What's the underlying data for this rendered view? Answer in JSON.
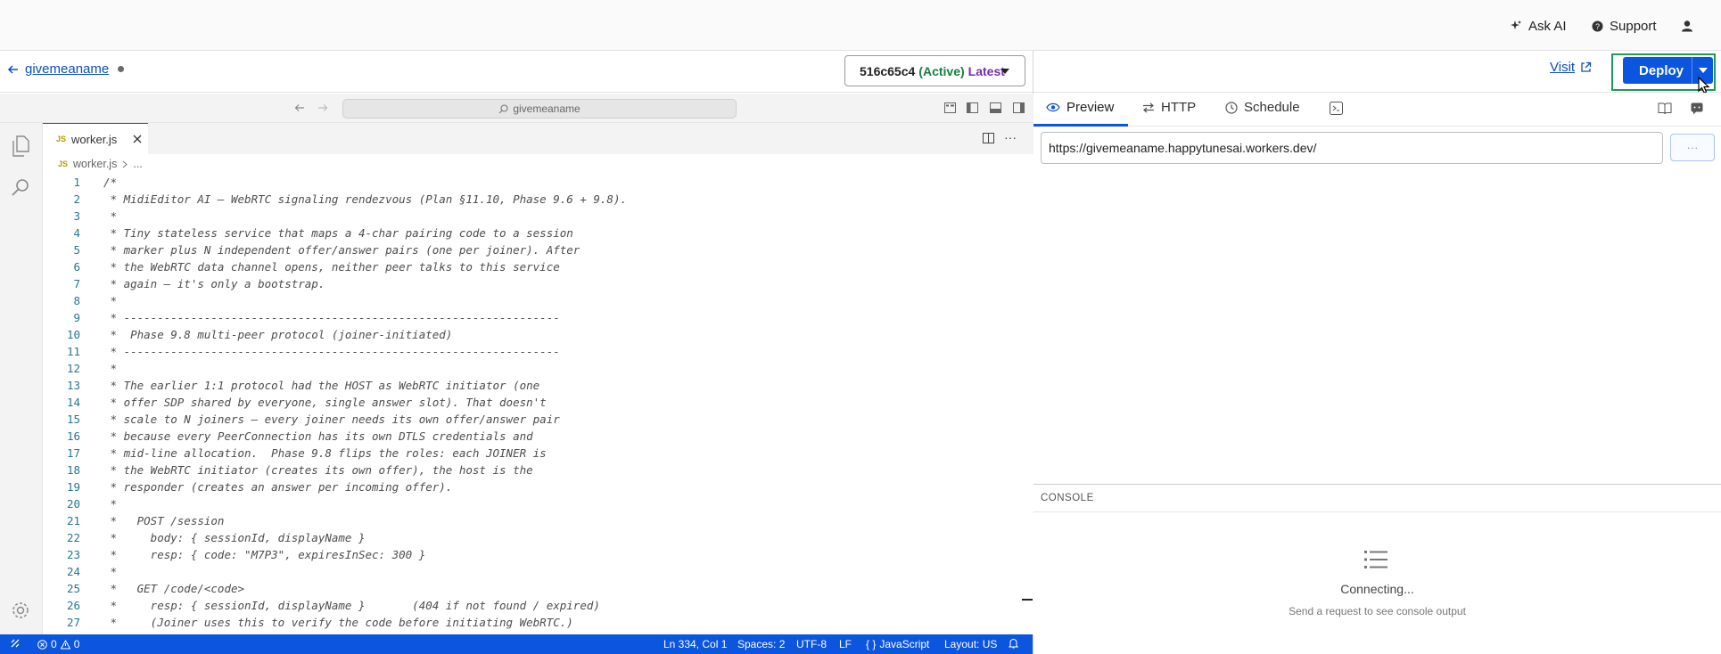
{
  "topbar": {
    "ask_ai": "Ask AI",
    "support": "Support"
  },
  "worker": {
    "name": "givemeaname",
    "version_id": "516c65c4",
    "version_status": "(Active)",
    "version_tag": "Latest"
  },
  "actions": {
    "visit": "Visit",
    "deploy": "Deploy"
  },
  "editor": {
    "search_placeholder": "givemeaname",
    "tab_badge": "JS",
    "tab_label": "worker.js",
    "breadcrumb_file": "worker.js",
    "breadcrumb_more": "...",
    "lines": [
      "/*",
      " * MidiEditor AI — WebRTC signaling rendezvous (Plan §11.10, Phase 9.6 + 9.8).",
      " *",
      " * Tiny stateless service that maps a 4-char pairing code to a session",
      " * marker plus N independent offer/answer pairs (one per joiner). After",
      " * the WebRTC data channel opens, neither peer talks to this service",
      " * again — it's only a bootstrap.",
      " *",
      " * -----------------------------------------------------------------",
      " *  Phase 9.8 multi-peer protocol (joiner-initiated)",
      " * -----------------------------------------------------------------",
      " *",
      " * The earlier 1:1 protocol had the HOST as WebRTC initiator (one",
      " * offer SDP shared by everyone, single answer slot). That doesn't",
      " * scale to N joiners — every joiner needs its own offer/answer pair",
      " * because every PeerConnection has its own DTLS credentials and",
      " * mid-line allocation.  Phase 9.8 flips the roles: each JOINER is",
      " * the WebRTC initiator (creates its own offer), the host is the",
      " * responder (creates an answer per incoming offer).",
      " *",
      " *   POST /session",
      " *     body: { sessionId, displayName }",
      " *     resp: { code: \"M7P3\", expiresInSec: 300 }",
      " *",
      " *   GET /code/<code>",
      " *     resp: { sessionId, displayName }       (404 if not found / expired)",
      " *     (Joiner uses this to verify the code before initiating WebRTC.)"
    ],
    "line_numbers": [
      "1",
      "2",
      "3",
      "4",
      "5",
      "6",
      "7",
      "8",
      "9",
      "10",
      "11",
      "12",
      "13",
      "14",
      "15",
      "16",
      "17",
      "18",
      "19",
      "20",
      "21",
      "22",
      "23",
      "24",
      "25",
      "26",
      "27"
    ]
  },
  "statusbar": {
    "errors": "0",
    "warnings": "0",
    "position": "Ln 334, Col 1",
    "spaces": "Spaces: 2",
    "encoding": "UTF-8",
    "eol": "LF",
    "language": "JavaScript",
    "layout": "Layout: US"
  },
  "panel": {
    "tabs": [
      "Preview",
      "HTTP",
      "Schedule"
    ],
    "url_value": "https://givemeaname.happytunesai.workers.dev/",
    "send_label": "···",
    "console_title": "CONSOLE",
    "console_status": "Connecting...",
    "console_hint": "Send a request to see console output"
  },
  "colors": {
    "accent": "#0b55df",
    "link": "#0a4ec9",
    "active_status": "#14803c",
    "latest_tag": "#7a2ab0",
    "deploy_highlight": "#1b9a5a"
  },
  "icons": {
    "ask_ai": "sparkle-icon",
    "support": "help-circle-icon",
    "user": "user-icon",
    "back": "arrow-left-icon",
    "visit": "external-link-icon",
    "dropdown": "chevron-down-icon"
  }
}
